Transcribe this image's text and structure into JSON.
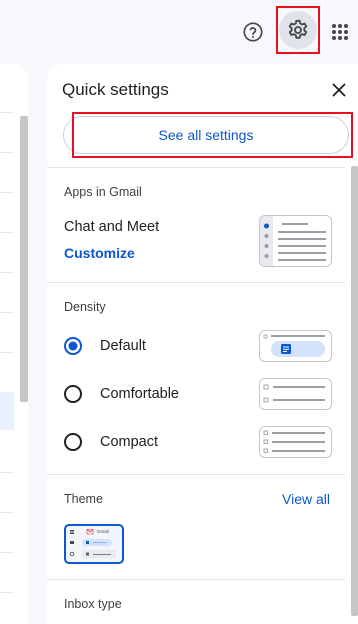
{
  "topbar": {
    "help_icon": "help-circle-icon",
    "settings_icon": "gear-icon",
    "apps_icon": "apps-grid-icon"
  },
  "quick_settings": {
    "title": "Quick settings",
    "close_icon": "close-icon",
    "see_all_label": "See all settings",
    "apps_section": {
      "title": "Apps in Gmail",
      "value": "Chat and Meet",
      "customize_label": "Customize"
    },
    "density_section": {
      "title": "Density",
      "options": [
        {
          "label": "Default",
          "selected": true
        },
        {
          "label": "Comfortable",
          "selected": false
        },
        {
          "label": "Compact",
          "selected": false
        }
      ]
    },
    "theme_section": {
      "title": "Theme",
      "view_all_label": "View all",
      "preview_logo_text": "Gmail"
    },
    "inbox_section": {
      "title": "Inbox type"
    }
  },
  "colors": {
    "accent": "#0b57d0",
    "highlight": "#e8101f",
    "selected_bg": "#dfe3ea"
  }
}
